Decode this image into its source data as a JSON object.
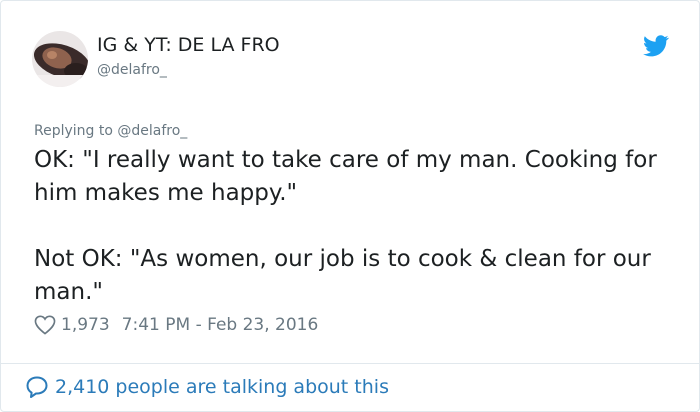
{
  "user": {
    "display_name": "IG & YT: DE LA FRO",
    "handle": "@delafro_"
  },
  "reply": {
    "text": "Replying to @delafro_"
  },
  "tweet": {
    "paragraphs": [
      "OK: \"I really want to take care of my man. Cooking for him makes me happy.\"",
      "Not OK: \"As women, our job is to cook & clean for our man.\""
    ],
    "like_count": "1,973",
    "timestamp": "7:41 PM - Feb 23, 2016"
  },
  "footer": {
    "conversation_text": "2,410 people are talking about this"
  },
  "icons": {
    "logo": "twitter-bird-icon",
    "like": "heart-icon",
    "reply": "speech-bubble-icon"
  },
  "colors": {
    "brand_blue": "#1da1f2",
    "link_blue": "#2b7bb9",
    "text": "#1c2022",
    "muted": "#697882",
    "border": "#e1e8ed"
  }
}
